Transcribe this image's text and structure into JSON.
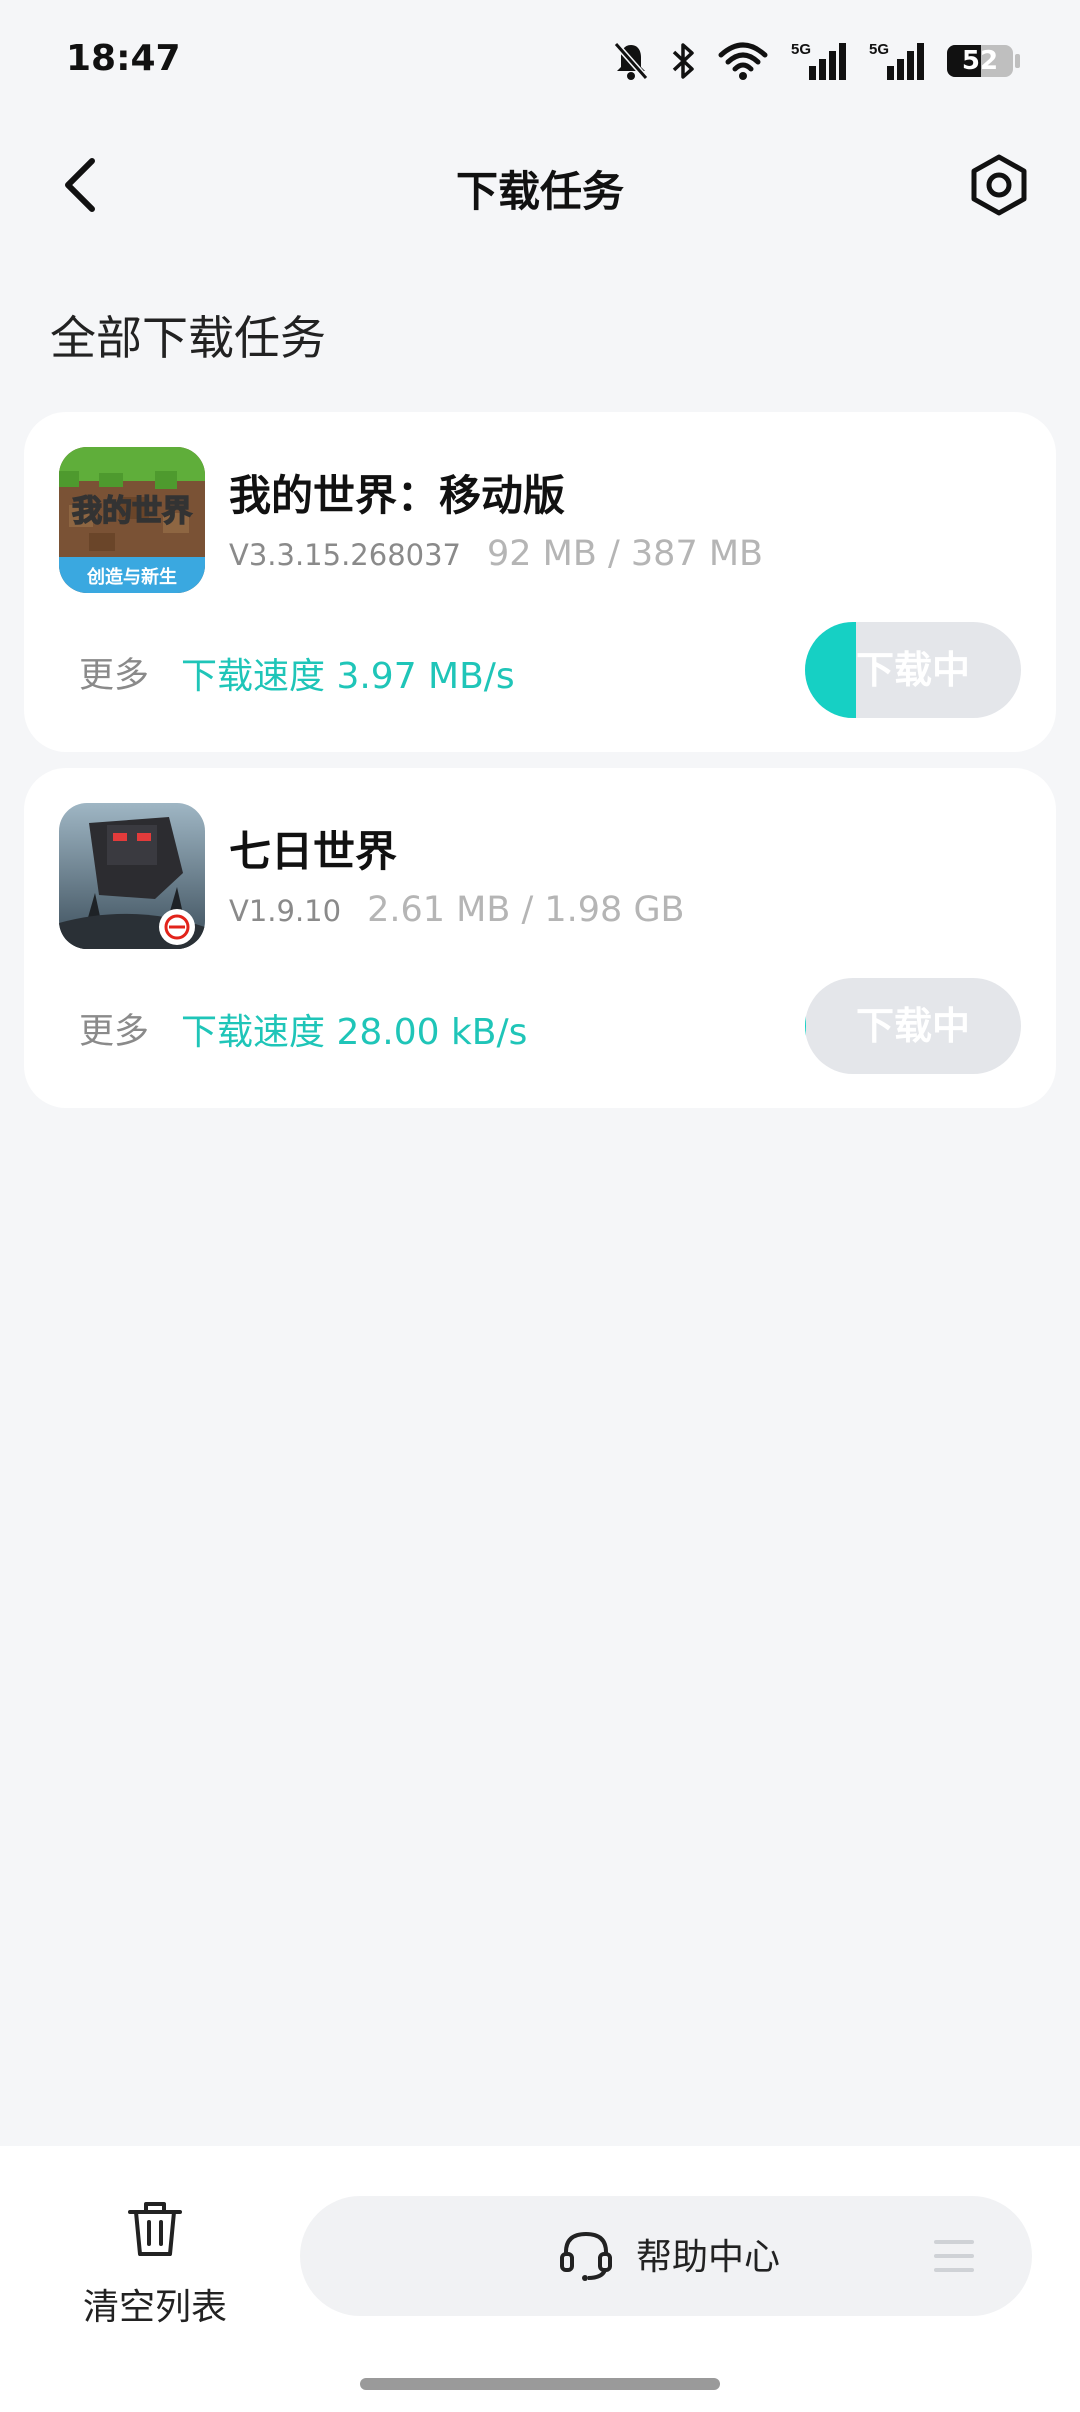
{
  "status_bar": {
    "time": "18:47",
    "battery": "52",
    "icons": [
      "bell-off-icon",
      "bluetooth-icon",
      "wifi-icon",
      "signal-5g-icon",
      "signal-5g-icon",
      "battery-icon"
    ]
  },
  "header": {
    "title": "下载任务",
    "back_icon": "chevron-left-icon",
    "settings_icon": "hexagon-settings-icon"
  },
  "section_title": "全部下载任务",
  "tasks": [
    {
      "name": "我的世界：移动版",
      "version": "V3.3.15.268037",
      "size": "92 MB / 387 MB",
      "more_label": "更多",
      "speed": "下载速度 3.97 MB/s",
      "button_label": "下载中",
      "progress": 0.238,
      "icon_text": "我的世界",
      "icon_subtext": "创造与新生"
    },
    {
      "name": "七日世界",
      "version": "V1.9.10",
      "size": "2.61 MB / 1.98 GB",
      "more_label": "更多",
      "speed": "下载速度 28.00 kB/s",
      "button_label": "下载中",
      "progress": 0.0013
    }
  ],
  "bottom_bar": {
    "clear_label": "清空列表",
    "help_label": "帮助中心"
  },
  "colors": {
    "accent": "#16d0c4",
    "speed_text": "#1fc5b8",
    "background": "#f5f6f8"
  }
}
